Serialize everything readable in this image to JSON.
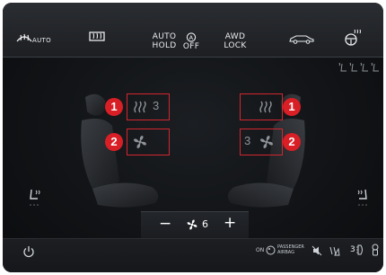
{
  "top_bar": {
    "auto_label": "AUTO",
    "auto_hold": {
      "line1": "AUTO",
      "line2": "HOLD"
    },
    "auto_off": {
      "line1": "OFF"
    },
    "awd_lock": {
      "line1": "AWD",
      "line2": "LOCK"
    }
  },
  "driver": {
    "heat_level": "3",
    "badge_heat": "1",
    "badge_fan": "2"
  },
  "passenger": {
    "vent_level": "3",
    "badge_heat": "1",
    "badge_fan": "2"
  },
  "fan": {
    "minus": "−",
    "speed": "6",
    "plus": "+"
  },
  "bottom_bar": {
    "passenger_airbag": {
      "on": "ON",
      "line1": "PASSENGER",
      "line2": "AIRBAG"
    },
    "level_value": "3"
  },
  "colors": {
    "highlight": "#d2262e",
    "badge": "#d81f26"
  }
}
